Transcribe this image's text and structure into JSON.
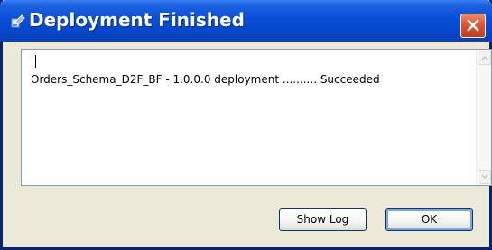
{
  "window": {
    "title": "Deployment Finished",
    "title_icon": "deploy-icon",
    "close_icon": "close-icon"
  },
  "log": {
    "lines": [
      "Orders_Schema_D2F_BF - 1.0.0.0 deployment .......... Succeeded"
    ]
  },
  "buttons": {
    "show_log": "Show Log",
    "ok": "OK"
  },
  "colors": {
    "titlebar": "#0548cd",
    "close": "#e35a32",
    "face": "#ece9d8"
  }
}
